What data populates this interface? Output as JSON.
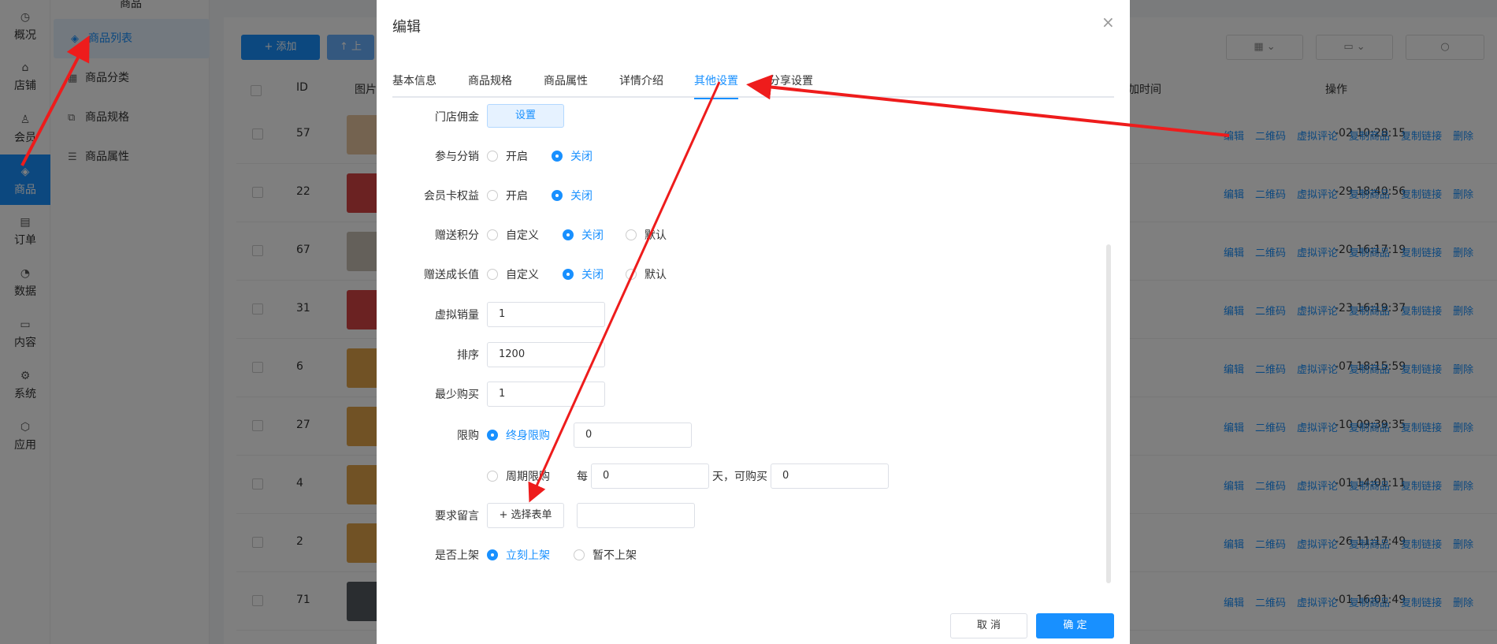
{
  "rail": {
    "items": [
      {
        "label": "概况",
        "icon": "dashboard-icon"
      },
      {
        "label": "店铺",
        "icon": "store-icon"
      },
      {
        "label": "会员",
        "icon": "user-icon"
      },
      {
        "label": "商品",
        "icon": "product-icon"
      },
      {
        "label": "订单",
        "icon": "order-icon"
      },
      {
        "label": "数据",
        "icon": "chart-icon"
      },
      {
        "label": "内容",
        "icon": "content-icon"
      },
      {
        "label": "系统",
        "icon": "gear-icon"
      },
      {
        "label": "应用",
        "icon": "app-icon"
      }
    ]
  },
  "subnav": {
    "header": "商品",
    "items": [
      {
        "label": "商品列表"
      },
      {
        "label": "商品分类"
      },
      {
        "label": "商品规格"
      },
      {
        "label": "商品属性"
      }
    ]
  },
  "list": {
    "add_label": "+ 添加",
    "upload_label": "↑ 上",
    "headers": {
      "id": "ID",
      "image": "图片",
      "time": "加时间",
      "ops": "操作"
    },
    "ops": [
      "编辑",
      "二维码",
      "虚拟评论",
      "复制商品",
      "复制链接",
      "删除"
    ],
    "rows": [
      {
        "id": "57",
        "time": "-02 10:28:15"
      },
      {
        "id": "22",
        "time": "-29 18:40:56"
      },
      {
        "id": "67",
        "time": "-20 16:17:19"
      },
      {
        "id": "31",
        "time": "-23 16:19:37"
      },
      {
        "id": "6",
        "time": "-07 18:15:59"
      },
      {
        "id": "27",
        "time": "-10 09:39:35"
      },
      {
        "id": "4",
        "time": "-01 14:01:11"
      },
      {
        "id": "2",
        "time": "-26 11:17:49"
      },
      {
        "id": "71",
        "time": "-01 16:01:49"
      }
    ]
  },
  "dialog": {
    "title": "编辑",
    "close": "×",
    "tabs": [
      "基本信息",
      "商品规格",
      "商品属性",
      "详情介绍",
      "其他设置",
      "分享设置"
    ],
    "active_tab": "其他设置",
    "form": {
      "store_commission": {
        "label": "门店佣金",
        "button": "设置"
      },
      "distribution": {
        "label": "参与分销",
        "options": [
          "开启",
          "关闭"
        ],
        "selected": "关闭"
      },
      "member_card": {
        "label": "会员卡权益",
        "options": [
          "开启",
          "关闭"
        ],
        "selected": "关闭"
      },
      "points": {
        "label": "赠送积分",
        "options": [
          "自定义",
          "关闭",
          "默认"
        ],
        "selected": "关闭"
      },
      "growth": {
        "label": "赠送成长值",
        "options": [
          "自定义",
          "关闭",
          "默认"
        ],
        "selected": "关闭"
      },
      "virtual_sales": {
        "label": "虚拟销量",
        "value": "1"
      },
      "sort": {
        "label": "排序",
        "value": "1200"
      },
      "min_buy": {
        "label": "最少购买",
        "value": "1"
      },
      "limit": {
        "label": "限购",
        "lifetime_label": "终身限购",
        "lifetime_value": "0",
        "period_label": "周期限购",
        "every": "每",
        "period_value": "0",
        "days_text": "天，可购买",
        "qty_value": "0"
      },
      "message": {
        "label": "要求留言",
        "button": "+ 选择表单",
        "value": ""
      },
      "on_shelf": {
        "label": "是否上架",
        "options": [
          "立刻上架",
          "暂不上架"
        ],
        "selected": "立刻上架"
      }
    },
    "cancel_label": "取 消",
    "ok_label": "确 定"
  },
  "colors": {
    "primary": "#1890ff",
    "annotation": "#ee1c1c"
  }
}
